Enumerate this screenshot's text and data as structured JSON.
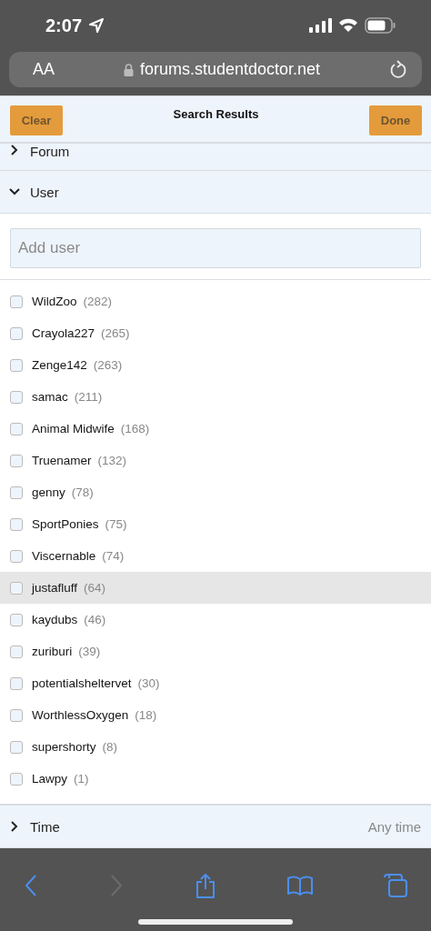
{
  "status_bar": {
    "time": "2:07"
  },
  "browser": {
    "text_size": "AA",
    "url": "forums.studentdoctor.net"
  },
  "header": {
    "title": "Search Results",
    "buttons": [
      "Clear",
      "Done"
    ]
  },
  "sections": [
    {
      "label": "Forum",
      "expanded": false
    },
    {
      "label": "User",
      "expanded": true
    }
  ],
  "user_field": {
    "placeholder": "Add user"
  },
  "users": [
    {
      "name": "WildZoo",
      "count": "(282)",
      "checked": false,
      "highlighted": false
    },
    {
      "name": "Crayola227",
      "count": "(265)",
      "checked": false,
      "highlighted": false
    },
    {
      "name": "Zenge142",
      "count": "(263)",
      "checked": false,
      "highlighted": false
    },
    {
      "name": "samac",
      "count": "(211)",
      "checked": false,
      "highlighted": false
    },
    {
      "name": "Animal Midwife",
      "count": "(168)",
      "checked": false,
      "highlighted": false
    },
    {
      "name": "Truenamer",
      "count": "(132)",
      "checked": false,
      "highlighted": false
    },
    {
      "name": "genny",
      "count": "(78)",
      "checked": false,
      "highlighted": false
    },
    {
      "name": "SportPonies",
      "count": "(75)",
      "checked": false,
      "highlighted": false
    },
    {
      "name": "Viscernable",
      "count": "(74)",
      "checked": false,
      "highlighted": false
    },
    {
      "name": "justafluff",
      "count": "(64)",
      "checked": false,
      "highlighted": true
    },
    {
      "name": "kaydubs",
      "count": "(46)",
      "checked": false,
      "highlighted": false
    },
    {
      "name": "zuriburi",
      "count": "(39)",
      "checked": false,
      "highlighted": false
    },
    {
      "name": "potentialsheltervet",
      "count": "(30)",
      "checked": false,
      "highlighted": false
    },
    {
      "name": "WorthlessOxygen",
      "count": "(18)",
      "checked": false,
      "highlighted": false
    },
    {
      "name": "supershorty",
      "count": "(8)",
      "checked": false,
      "highlighted": false
    },
    {
      "name": "Lawpy",
      "count": "(1)",
      "checked": false,
      "highlighted": false
    }
  ],
  "time_section": {
    "label": "Time",
    "expanded": false,
    "value": "Any time"
  }
}
